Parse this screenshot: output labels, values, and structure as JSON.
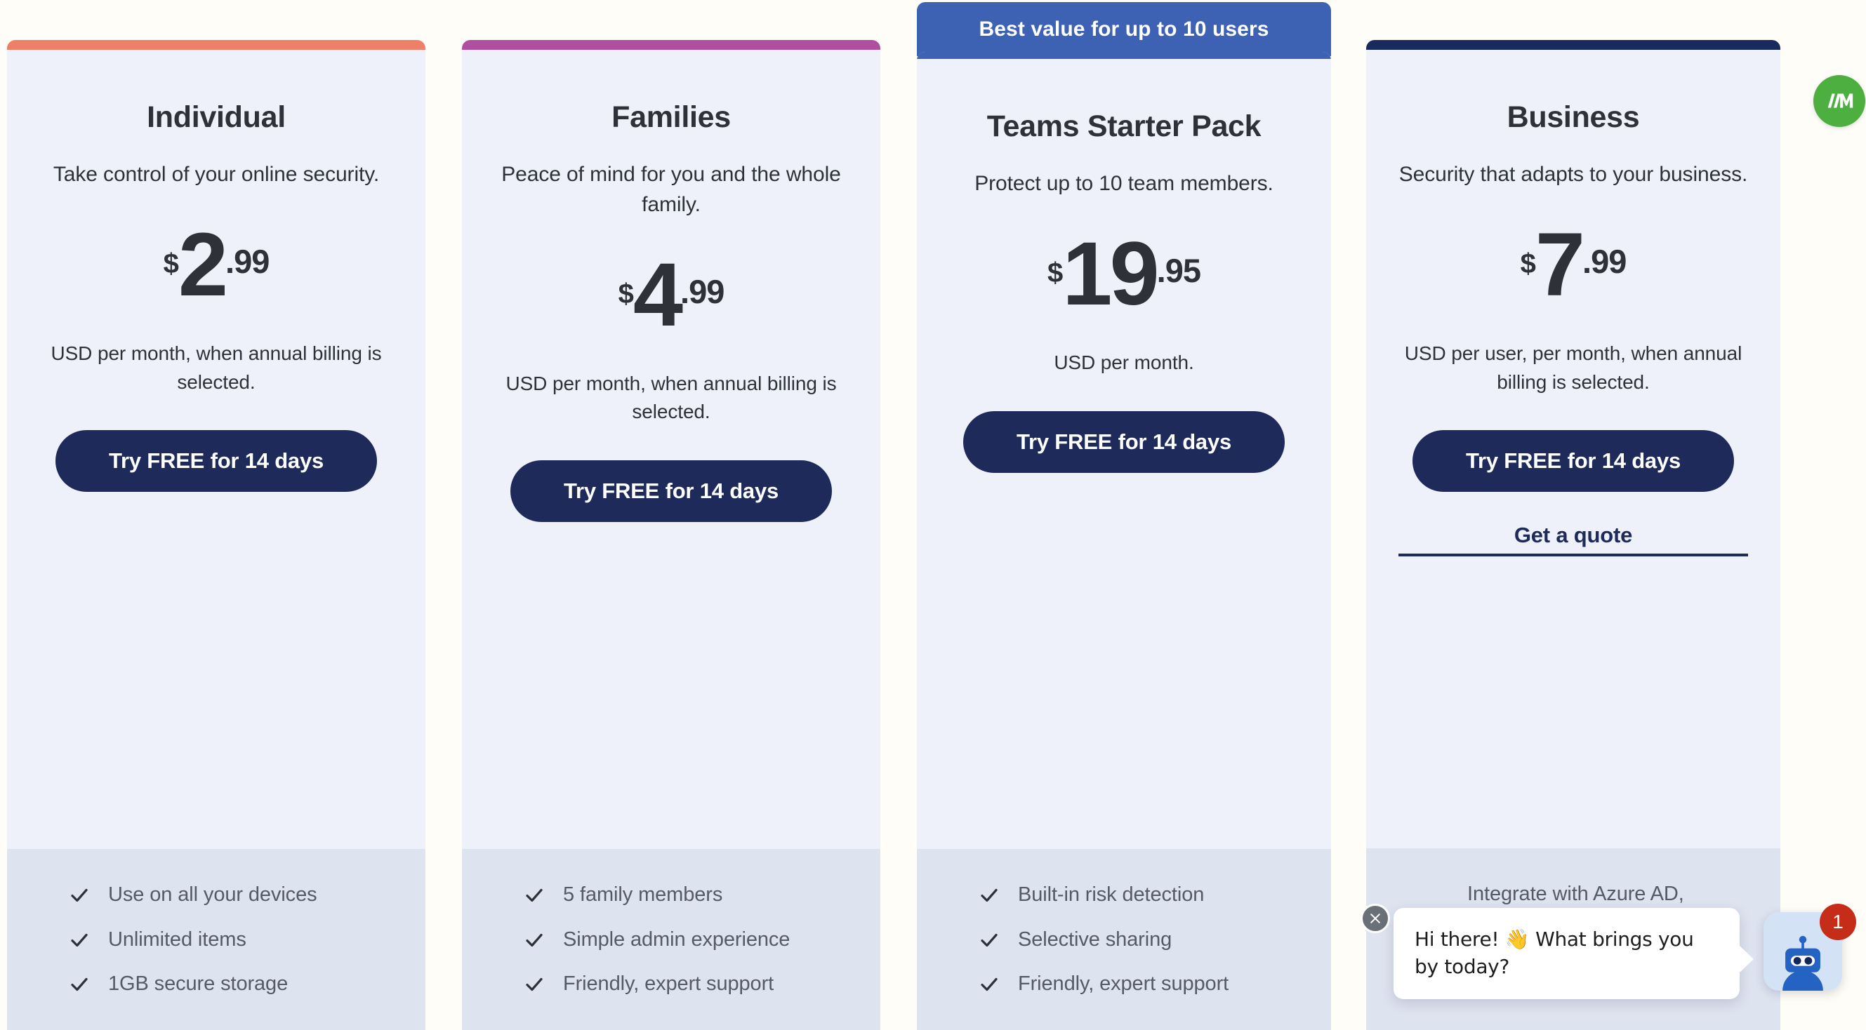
{
  "brand": {
    "logo_icon": "slash-m-logo-icon",
    "logo_color": "#4caf3f"
  },
  "colors": {
    "page_background": "#fffdf7",
    "card_background": "#eef1fa",
    "features_background": "#dee3f0",
    "cta_navy": "#1e2a5a",
    "badge_blue": "#3d62b4",
    "text_dark": "#2e3238",
    "text_muted": "#555b66"
  },
  "featured_badge": {
    "label": "Best value for up to 10 users",
    "color": "#3d62b4"
  },
  "plans": [
    {
      "id": "individual",
      "title": "Individual",
      "tagline": "Take control of your online security.",
      "accent_color": "#ed8066",
      "price": {
        "currency": "$",
        "whole": "2",
        "cents": ".99"
      },
      "price_note": "USD per month, when annual billing is selected.",
      "cta_label": "Try FREE for 14 days",
      "secondary_link": null,
      "features": [
        "Use on all your devices",
        "Unlimited items",
        "1GB secure storage"
      ]
    },
    {
      "id": "families",
      "title": "Families",
      "tagline": "Peace of mind for you and the whole family.",
      "accent_color": "#b04fa0",
      "price": {
        "currency": "$",
        "whole": "4",
        "cents": ".99"
      },
      "price_note": "USD per month, when annual billing is selected.",
      "cta_label": "Try FREE for 14 days",
      "secondary_link": null,
      "features": [
        "5 family members",
        "Simple admin experience",
        "Friendly, expert support"
      ]
    },
    {
      "id": "teams-starter-pack",
      "title": "Teams Starter Pack",
      "tagline": "Protect up to 10 team members.",
      "accent_color": "#3d62b4",
      "price": {
        "currency": "$",
        "whole": "19",
        "cents": ".95"
      },
      "price_note": "USD per month.",
      "cta_label": "Try FREE for 14 days",
      "secondary_link": null,
      "features": [
        "Built-in risk detection",
        "Selective sharing",
        "Friendly, expert support"
      ]
    },
    {
      "id": "business",
      "title": "Business",
      "tagline": "Security that adapts to your business.",
      "accent_color": "#1b2a5e",
      "price": {
        "currency": "$",
        "whole": "7",
        "cents": ".99"
      },
      "price_note": "USD per user, per month, when annual billing is selected.",
      "cta_label": "Try FREE for 14 days",
      "secondary_link": "Get a quote",
      "features": [
        "Integrate with Azure AD, OneLogin, Slack, Duo, and more",
        ""
      ]
    }
  ],
  "chat": {
    "message": "Hi there! 👋 What brings you by today?",
    "close_icon": "close-icon",
    "launcher_icon": "chat-robot-icon",
    "unread_count": "1"
  }
}
